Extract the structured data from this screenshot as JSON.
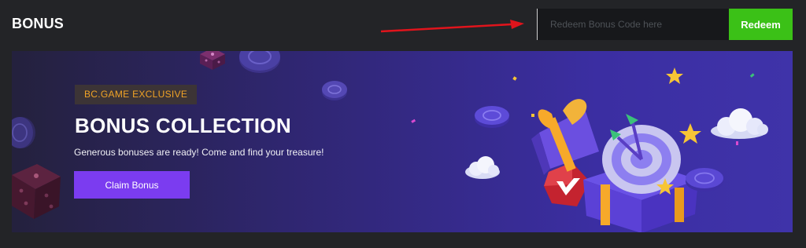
{
  "header": {
    "title": "BONUS"
  },
  "redeem": {
    "placeholder": "Redeem Bonus Code here",
    "button_label": "Redeem"
  },
  "banner": {
    "badge": "BC.GAME EXCLUSIVE",
    "headline": "BONUS COLLECTION",
    "subtext": "Generous bonuses are ready! Come and find your treasure!",
    "cta_label": "Claim Bonus"
  },
  "colors": {
    "page_bg": "#232427",
    "banner_purple": "#3b2ea2",
    "redeem_green": "#3bc117",
    "cta_purple": "#7b3cf0",
    "badge_text": "#f0a326",
    "arrow_red": "#e0141c"
  },
  "icons": [
    "arrow-annotation-icon",
    "dice-icon",
    "coin-icon",
    "gift-box-icon",
    "target-icon",
    "dart-icon",
    "star-icon",
    "cloud-icon",
    "chip-icon"
  ]
}
